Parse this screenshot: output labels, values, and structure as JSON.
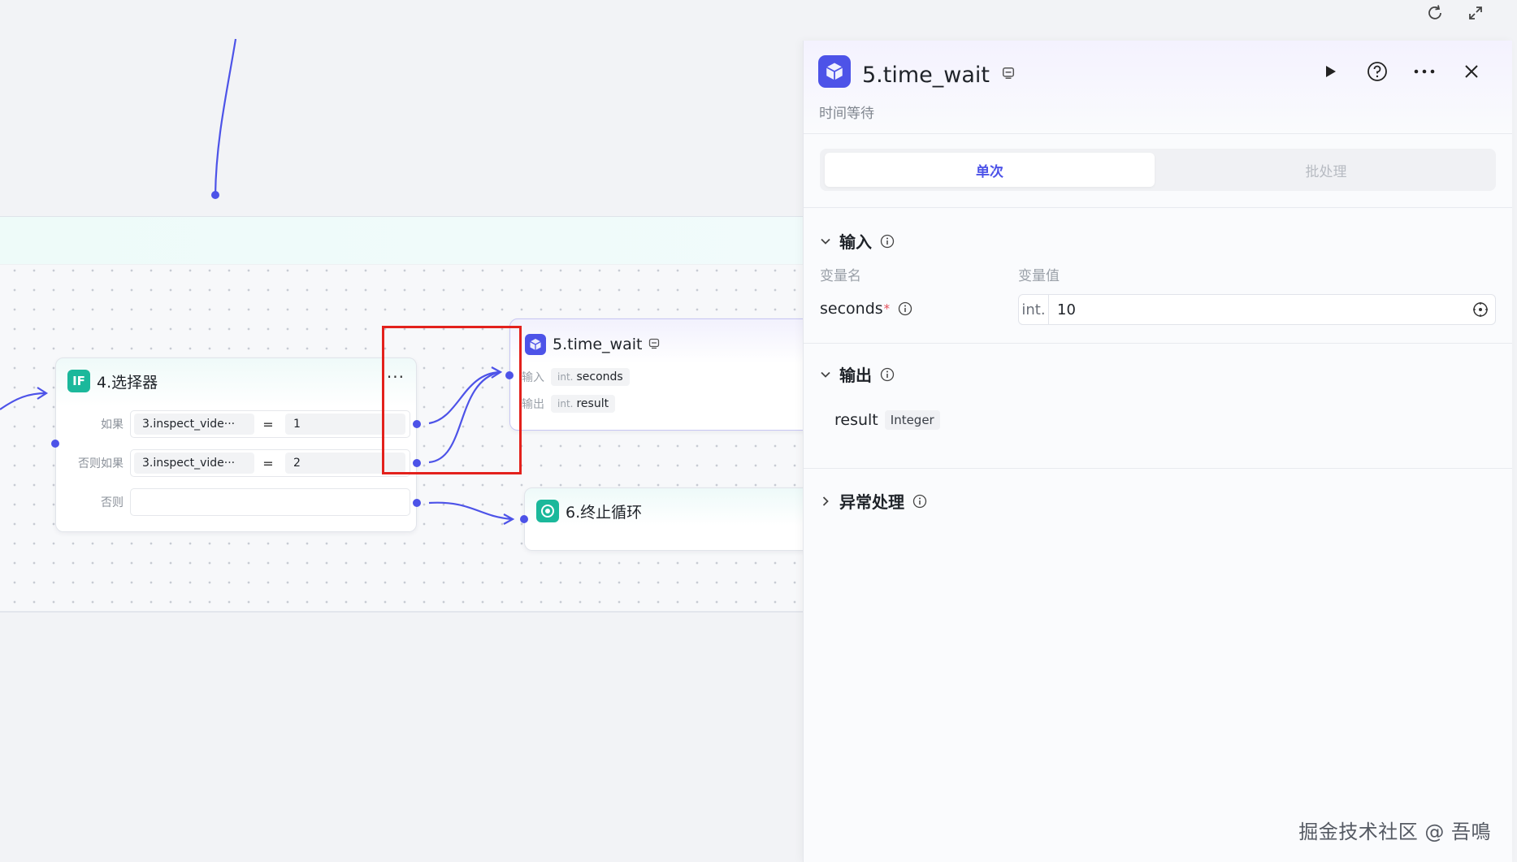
{
  "canvas": {
    "selector_node": {
      "title": "4.选择器",
      "icon": "IF",
      "more": "···",
      "conditions": [
        {
          "label": "如果",
          "left": "3.inspect_vide···",
          "op": "=",
          "right": "1"
        },
        {
          "label": "否则如果",
          "left": "3.inspect_vide···",
          "op": "=",
          "right": "2"
        },
        {
          "label": "否则",
          "left": "",
          "op": "",
          "right": ""
        }
      ]
    },
    "time_wait_node": {
      "title": "5.time_wait",
      "input_label": "输入",
      "input_type": "int.",
      "input_name": "seconds",
      "output_label": "输出",
      "output_type": "int.",
      "output_name": "result"
    },
    "end_loop_node": {
      "title": "6.终止循环"
    }
  },
  "panel": {
    "title": "5.time_wait",
    "subtitle": "时间等待",
    "tabs": [
      "单次",
      "批处理"
    ],
    "active_tab": "单次",
    "input_section": {
      "title": "输入",
      "col_name": "变量名",
      "col_value": "变量值",
      "var_name": "seconds",
      "required_mark": "*",
      "var_type": "int.",
      "var_value": "10"
    },
    "output_section": {
      "title": "输出",
      "name": "result",
      "type": "Integer"
    },
    "exception_section": {
      "title": "异常处理"
    }
  },
  "watermark": "掘金技术社区 @ 吾鳴",
  "colors": {
    "accent": "#4d53e8",
    "if_green": "#1bb89b",
    "highlight_red": "#e3211c"
  }
}
